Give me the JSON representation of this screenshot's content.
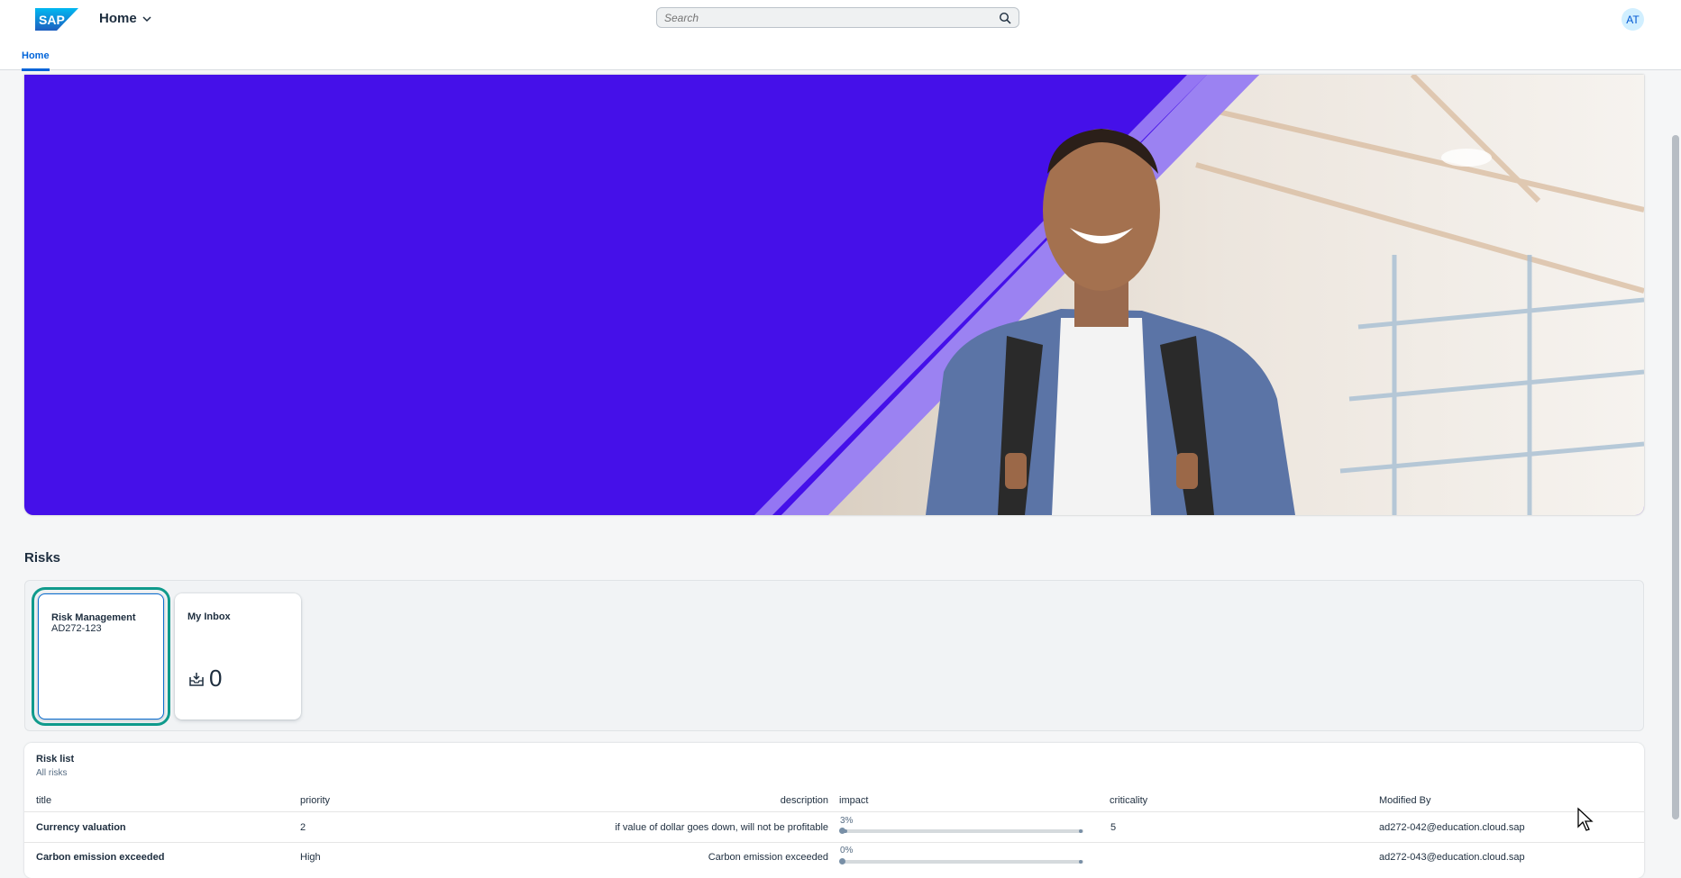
{
  "shell": {
    "logo_text": "SAP",
    "home_menu_label": "Home",
    "search_placeholder": "Search",
    "avatar_initials": "AT",
    "tabs": [
      {
        "label": "Home"
      }
    ]
  },
  "colors": {
    "brand_blue": "#0064d9",
    "hero_purple": "#4510e9",
    "tile_focus": "#0f9a8c"
  },
  "risks_section": {
    "title": "Risks",
    "tiles": [
      {
        "title": "Risk Management",
        "subtitle": "AD272-123",
        "icon": ""
      },
      {
        "title": "My Inbox",
        "subtitle": "",
        "icon": "inbox-icon",
        "kpi": "0"
      }
    ]
  },
  "risk_table": {
    "title": "Risk list",
    "subtitle": "All risks",
    "columns": [
      "title",
      "priority",
      "description",
      "impact",
      "criticality",
      "Modified By"
    ],
    "rows": [
      {
        "title": "Currency valuation",
        "priority": "2",
        "description": "if value of dollar goes down, will not be profitable",
        "impact_label": "3%",
        "impact_value": 3,
        "criticality": "5",
        "modified_by": "ad272-042@education.cloud.sap"
      },
      {
        "title": "Carbon emission exceeded",
        "priority": "High",
        "description": "Carbon emission exceeded",
        "impact_label": "0%",
        "impact_value": 0,
        "criticality": "",
        "modified_by": "ad272-043@education.cloud.sap"
      }
    ]
  }
}
